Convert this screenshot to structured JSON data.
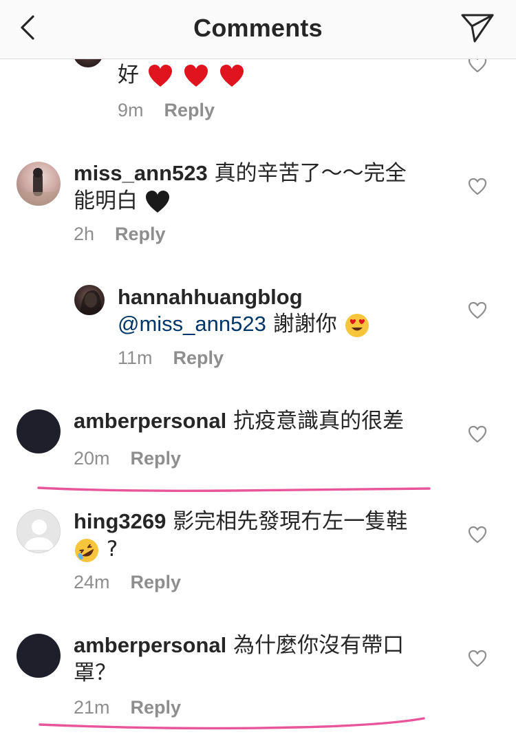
{
  "header": {
    "title": "Comments"
  },
  "reply_label": "Reply",
  "comments": [
    {
      "text": "好",
      "time": "9m"
    },
    {
      "username": "miss_ann523",
      "text_line1": "真的辛苦了～～完全",
      "text_line2": "能明白",
      "time": "2h"
    },
    {
      "username": "hannahhuangblog",
      "mention": "@miss_ann523",
      "text": "謝謝你",
      "time": "11m"
    },
    {
      "username": "amberpersonal",
      "text": "抗疫意識真的很差",
      "time": "20m"
    },
    {
      "username": "hing3269",
      "text_line1": "影完相先發現冇左一隻鞋",
      "text_line2": "?",
      "time": "24m"
    },
    {
      "username": "amberpersonal",
      "text_line1": "為什麼你沒有帶口",
      "text_line2": "罩？",
      "time": "21m"
    }
  ],
  "icons": {
    "back": "chevron-left-icon",
    "send": "paper-plane-icon",
    "like": "heart-outline-icon"
  },
  "colors": {
    "highlight_underline": "#e8559a",
    "mention": "#003569",
    "heart_emoji": "#e0141e",
    "black_heart": "#1a1a1a",
    "emoji_face": "#f7c53b"
  }
}
